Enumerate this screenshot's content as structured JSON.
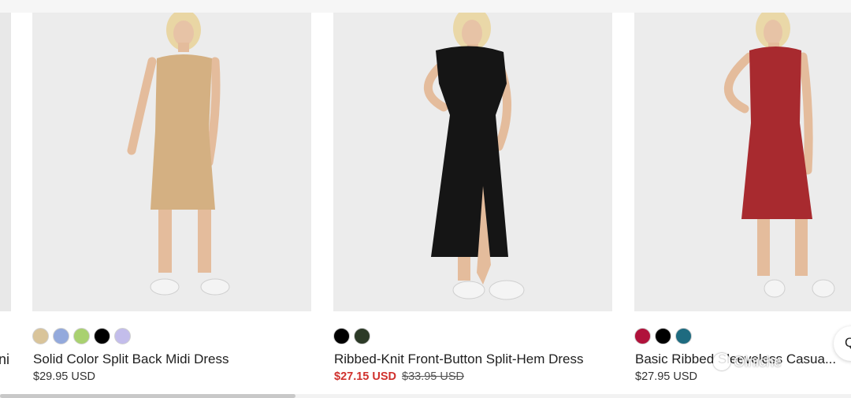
{
  "colors": {
    "image_bg": "#ececec",
    "sale_price": "#d0312d",
    "text": "#1e1e1e"
  },
  "partial_left": {
    "title_fragment": "ni"
  },
  "products": [
    {
      "title": "Solid Color Split Back Midi Dress",
      "price": "$29.95 USD",
      "dress_color": "#d4b082",
      "swatches": [
        "#d9c49a",
        "#93a9dc",
        "#a9d170",
        "#000000",
        "#c3bdeb"
      ]
    },
    {
      "title": "Ribbed-Knit Front-Button Split-Hem Dress",
      "price_sale": "$27.15 USD",
      "price_original": "$33.95 USD",
      "dress_color": "#151515",
      "swatches": [
        "#000000",
        "#2c3a27"
      ]
    },
    {
      "title": "Basic Ribbed Sleeveless Casua...",
      "price": "$27.95 USD",
      "dress_color": "#a82a2f",
      "swatches": [
        "#b0123b",
        "#000000",
        "#1e6b80"
      ]
    }
  ],
  "watermark": {
    "text": "Olniche",
    "icon": "wechat-icon"
  },
  "edge_button": {
    "icon": "search-icon",
    "glyph": "Q"
  }
}
